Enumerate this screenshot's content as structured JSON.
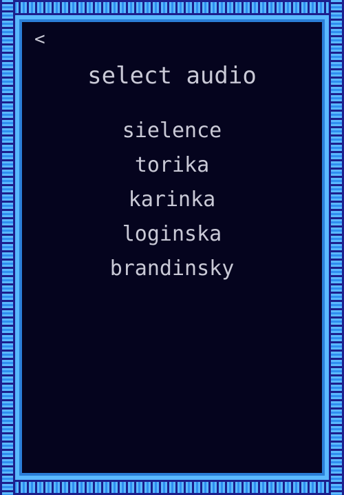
{
  "header": {
    "back_icon": "<",
    "title": "select audio"
  },
  "audio_options": [
    {
      "label": "sielence"
    },
    {
      "label": "torika"
    },
    {
      "label": "karinka"
    },
    {
      "label": "loginska"
    },
    {
      "label": "brandinsky"
    }
  ],
  "colors": {
    "background": "#05041e",
    "text": "#c9c9d6",
    "border_light": "#5ab9ff",
    "border_mid": "#2f8df0",
    "border_dark": "#1c1f8c"
  }
}
